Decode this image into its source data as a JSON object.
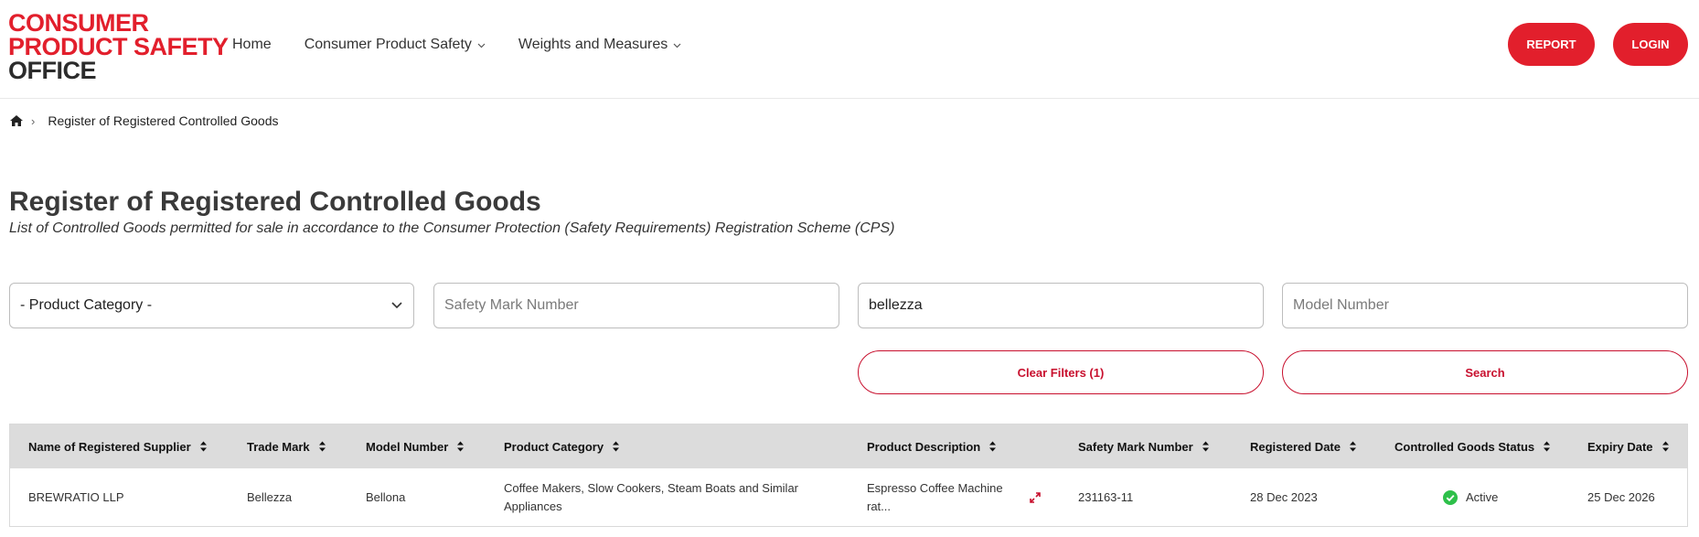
{
  "logo": {
    "line1": "CONSUMER",
    "line2": "PRODUCT SAFETY",
    "line3": "OFFICE"
  },
  "nav": {
    "home": "Home",
    "consumer_product_safety": "Consumer Product Safety",
    "weights_and_measures": "Weights and Measures",
    "chevron_icon": "chevron-down-icon"
  },
  "header_buttons": {
    "report": "REPORT",
    "login": "LOGIN"
  },
  "breadcrumb": {
    "home_icon": "home-icon",
    "current": "Register of Registered Controlled Goods"
  },
  "page": {
    "title": "Register of Registered Controlled Goods",
    "subtitle": "List of Controlled Goods permitted for sale in accordance to the Consumer Protection (Safety Requirements) Registration Scheme (CPS)"
  },
  "filters": {
    "product_category": "- Product Category -",
    "safety_mark_placeholder": "Safety Mark Number",
    "search_value": "bellezza",
    "model_number_placeholder": "Model Number",
    "clear_label": "Clear Filters (1)",
    "search_label": "Search"
  },
  "table": {
    "headers": [
      "Name of Registered Supplier",
      "Trade Mark",
      "Model Number",
      "Product Category",
      "Product Description",
      "Safety Mark Number",
      "Registered Date",
      "Controlled Goods Status",
      "Expiry Date"
    ],
    "rows": [
      {
        "supplier": "BREWRATIO LLP",
        "trade_mark": "Bellezza",
        "model_number": "Bellona",
        "category_line1": "Coffee Makers, Slow Cookers, Steam Boats and Similar",
        "category_line2": "Appliances",
        "description_line1": "Espresso Coffee Machine",
        "description_line2": "rat...",
        "safety_mark": "231163-11",
        "registered_date": "28 Dec 2023",
        "status": "Active",
        "expiry_date": "25 Dec 2026"
      }
    ]
  },
  "colors": {
    "brand_red": "#e21f2c",
    "active_green": "#2ec04a",
    "header_bg": "#dcdcdc"
  }
}
